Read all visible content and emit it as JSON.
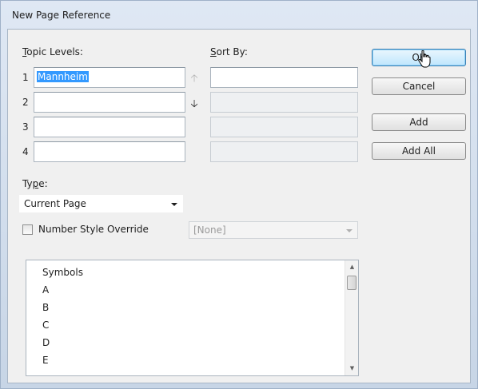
{
  "window": {
    "title": "New Page Reference"
  },
  "topic_levels": {
    "label": "Topic Levels:",
    "rows": [
      {
        "num": "1",
        "value": "Mannheim",
        "sort_value": ""
      },
      {
        "num": "2",
        "value": "",
        "sort_value": ""
      },
      {
        "num": "3",
        "value": "",
        "sort_value": ""
      },
      {
        "num": "4",
        "value": "",
        "sort_value": ""
      }
    ]
  },
  "sort_by": {
    "label": "Sort By:"
  },
  "buttons": {
    "ok": "OK",
    "cancel": "Cancel",
    "add": "Add",
    "add_all": "Add All"
  },
  "type": {
    "label": "Type:",
    "selected": "Current Page"
  },
  "number_style_override": {
    "label": "Number Style Override",
    "checked": false,
    "selected": "[None]"
  },
  "topic_list": {
    "items": [
      "Symbols",
      "A",
      "B",
      "C",
      "D",
      "E"
    ]
  },
  "icons": {
    "move_up": "arrow-up-icon",
    "move_down": "arrow-down-icon",
    "cursor": "mouse-pointer-icon"
  }
}
